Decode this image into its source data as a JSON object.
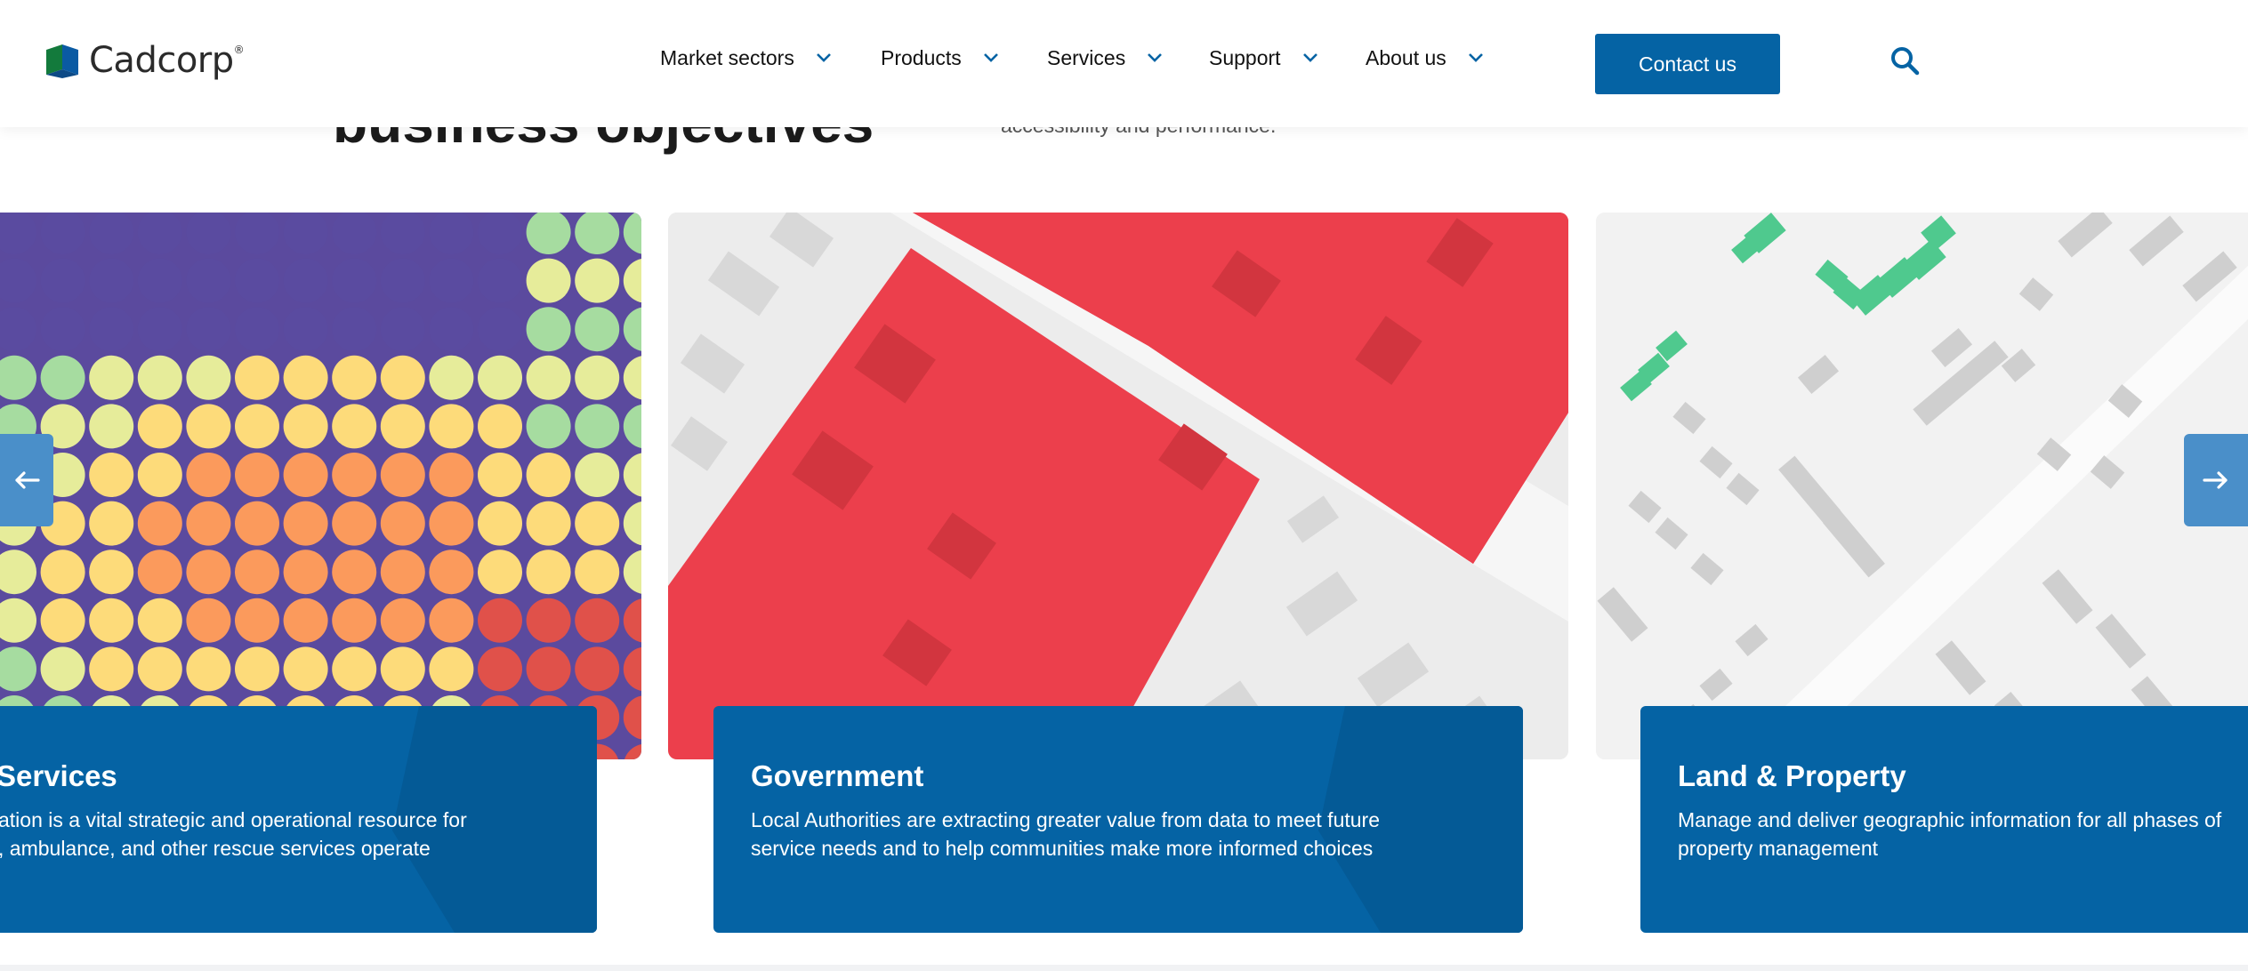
{
  "brand": {
    "name": "Cadcorp",
    "reg": "®"
  },
  "nav": {
    "items": [
      {
        "label": "Market sectors"
      },
      {
        "label": "Products"
      },
      {
        "label": "Services"
      },
      {
        "label": "Support"
      },
      {
        "label": "About us"
      }
    ],
    "contact_label": "Contact us"
  },
  "intro": {
    "heading": "business objectives",
    "text": "accessibility and performance."
  },
  "cards": [
    {
      "title": "Services",
      "desc_line1": "ation is a vital strategic and operational resource for",
      "desc_line2": ", ambulance, and other rescue services operate"
    },
    {
      "title": "Government",
      "desc_line1": "Local Authorities are extracting greater value from data to meet future",
      "desc_line2": "service needs and to help communities make more informed choices"
    },
    {
      "title": "Land & Property",
      "desc_line1": "Manage and deliver geographic information for all phases of",
      "desc_line2": "property management"
    }
  ],
  "colors": {
    "primary": "#0563a4",
    "arrow": "#4a8fc9",
    "red_area": "#ec3f4c",
    "green_area": "#4fc98e"
  },
  "icons": {
    "prev": "arrow-left-icon",
    "next": "arrow-right-icon",
    "search": "search-icon",
    "dropdown": "chevron-down-icon"
  }
}
